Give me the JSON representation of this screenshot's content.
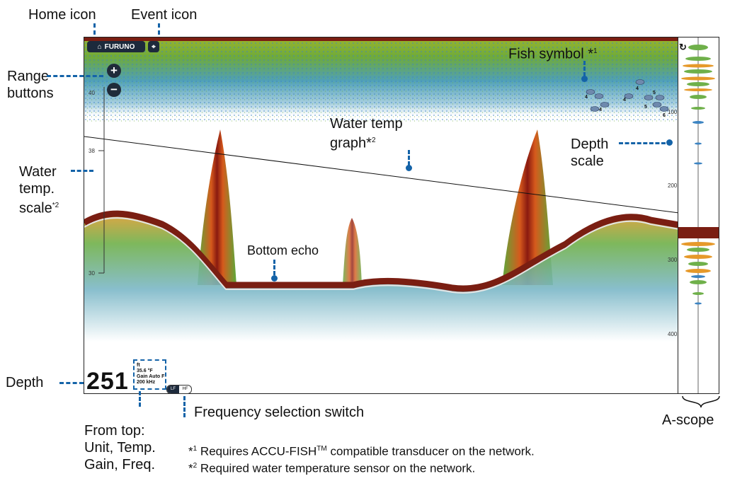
{
  "callouts": {
    "home_icon": "Home icon",
    "event_icon": "Event icon",
    "range_buttons_1": "Range",
    "range_buttons_2": "buttons",
    "water_temp_scale_1": "Water",
    "water_temp_scale_2": "temp.",
    "water_temp_scale_3": "scale",
    "water_temp_scale_sup": "*2",
    "fish_symbol": "Fish symbol *",
    "fish_symbol_sup": "1",
    "water_temp_graph_1": "Water temp",
    "water_temp_graph_2": "graph*",
    "water_temp_graph_sup": "2",
    "depth_scale_1": "Depth",
    "depth_scale_2": "scale",
    "bottom_echo": "Bottom echo",
    "depth": "Depth",
    "frequency_switch": "Frequency selection switch",
    "a_scope": "A-scope",
    "from_top_1": "From top:",
    "from_top_2": "Unit, Temp.",
    "from_top_3": "Gain, Freq."
  },
  "footnotes": {
    "note1_mark": "*",
    "note1_sup": "1",
    "note1_text_a": " Requires ACCU-FISH",
    "note1_tm": "TM",
    "note1_text_b": " compatible transducer on the network.",
    "note2_mark": "*",
    "note2_sup": "2",
    "note2_text": " Required water temperature sensor on the network."
  },
  "screen": {
    "brand": "FURUNO",
    "range_plus": "+",
    "range_minus": "−",
    "temp_scale": [
      "40",
      "38",
      "30"
    ],
    "depth_scale": [
      "100",
      "200",
      "300",
      "400"
    ],
    "depth_value": "251",
    "info_lines": [
      "ft",
      "35.6 °F",
      "Gain Auto F",
      "200 kHz"
    ],
    "freq_options": [
      "LF",
      "HF"
    ],
    "fish_sizes": [
      "4",
      "4",
      "4",
      "4",
      "5",
      "5",
      "6"
    ]
  },
  "colors": {
    "callout_blue": "#1463a8",
    "button_dark": "#1d2a3c",
    "bottom_echo": "#7a1e12"
  },
  "icons": [
    "home-icon",
    "event-pin-icon",
    "plus-icon",
    "minus-icon",
    "refresh-icon",
    "fish-symbol-icon"
  ]
}
